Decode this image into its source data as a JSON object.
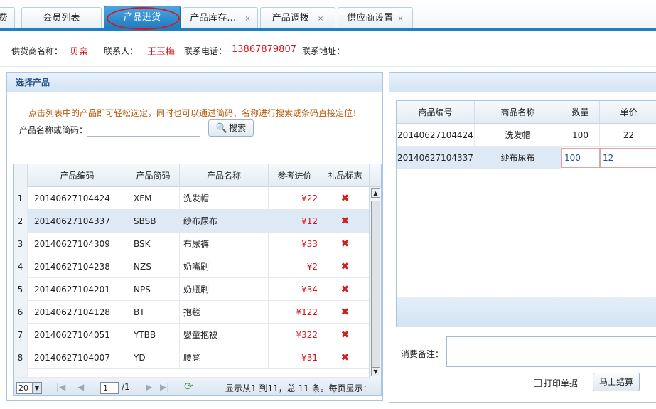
{
  "tabs": [
    {
      "label": "费",
      "closable": false,
      "active": false
    },
    {
      "label": "会员列表",
      "closable": false,
      "active": false
    },
    {
      "label": "产品进货",
      "closable": false,
      "active": true
    },
    {
      "label": "产品库存…",
      "closable": true,
      "active": false
    },
    {
      "label": "产品调拨",
      "closable": true,
      "active": false
    },
    {
      "label": "供应商设置",
      "closable": true,
      "active": false
    }
  ],
  "close_glyph": "×",
  "supplier": {
    "name_label": "供货商名称：",
    "name": "贝亲",
    "contact_label": "联系人：",
    "contact": "王玉梅",
    "phone_label": "联系电话：",
    "phone": "13867879807",
    "address_label": "联系地址："
  },
  "left_panel": {
    "title": "选择产品",
    "hint": "点击列表中的产品即可轻松选定，同时也可以通过简码、名称进行搜索或条码直接定位！",
    "search_label": "产品名称或简码：",
    "search_value": "",
    "search_button": "搜索",
    "columns": [
      "产品编码",
      "产品简码",
      "产品名称",
      "参考进价",
      "礼品标志"
    ],
    "rows": [
      {
        "idx": "1",
        "code": "20140627104424",
        "short": "XFM",
        "name": "洗发帽",
        "price": "¥22",
        "gift": "✖"
      },
      {
        "idx": "2",
        "code": "20140627104337",
        "short": "SBSB",
        "name": "纱布尿布",
        "price": "¥12",
        "gift": "✖"
      },
      {
        "idx": "3",
        "code": "20140627104309",
        "short": "BSK",
        "name": "布尿裤",
        "price": "¥33",
        "gift": "✖"
      },
      {
        "idx": "4",
        "code": "20140627104238",
        "short": "NZS",
        "name": "奶嘴刷",
        "price": "¥2",
        "gift": "✖"
      },
      {
        "idx": "5",
        "code": "20140627104201",
        "short": "NPS",
        "name": "奶瓶刷",
        "price": "¥34",
        "gift": "✖"
      },
      {
        "idx": "6",
        "code": "20140627104128",
        "short": "BT",
        "name": "抱毯",
        "price": "¥122",
        "gift": "✖"
      },
      {
        "idx": "7",
        "code": "20140627104051",
        "short": "YTBB",
        "name": "婴童抱被",
        "price": "¥322",
        "gift": "✖"
      },
      {
        "idx": "8",
        "code": "20140627104007",
        "short": "YD",
        "name": "腰凳",
        "price": "¥31",
        "gift": "✖"
      }
    ],
    "pager": {
      "page_size": "20",
      "page": "1",
      "total_pages": "/1",
      "status": "显示从1 到11，总 11 条。每页显示：20"
    }
  },
  "right_panel": {
    "columns": [
      "商品编号",
      "商品名称",
      "数量",
      "单价"
    ],
    "rows": [
      {
        "code": "20140627104424",
        "name": "洗发帽",
        "qty": "100",
        "price": "22"
      },
      {
        "code": "20140627104337",
        "name": "纱布尿布",
        "qty": "100",
        "price": "12"
      }
    ],
    "note_label": "消费备注：",
    "note_value": "",
    "print_label": "打印单据",
    "print_checked": false,
    "settle_button": "马上结算"
  }
}
